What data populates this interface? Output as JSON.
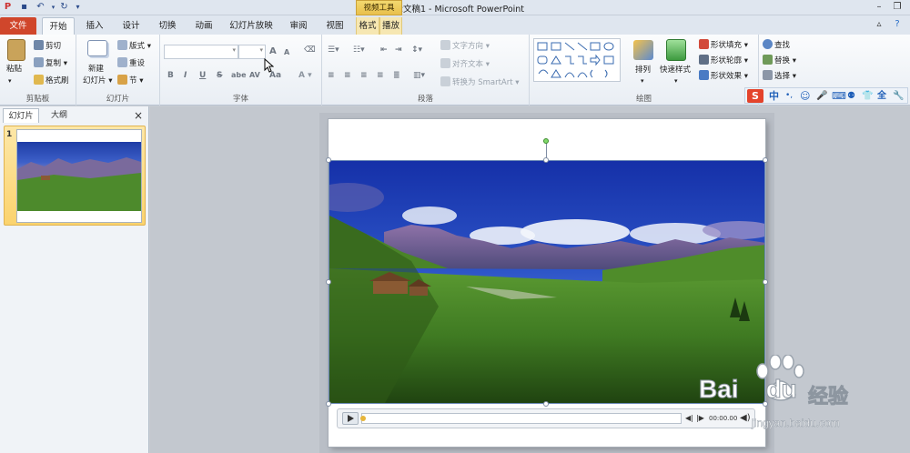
{
  "titlebar": {
    "title": "演示文稿1 - Microsoft PowerPoint",
    "context_tab_header": "视频工具"
  },
  "tabs": [
    "文件",
    "开始",
    "插入",
    "设计",
    "切换",
    "动画",
    "幻灯片放映",
    "审阅",
    "视图",
    "格式",
    "播放"
  ],
  "ribbon": {
    "clipboard": {
      "paste": "粘贴",
      "cut": "剪切",
      "copy": "复制",
      "format_painter": "格式刷",
      "label": "剪贴板"
    },
    "slides": {
      "new_slide_1": "新建",
      "new_slide_2": "幻灯片",
      "layout": "版式",
      "reset": "重设",
      "section": "节",
      "label": "幻灯片"
    },
    "font": {
      "bold": "B",
      "italic": "I",
      "underline": "U",
      "strike": "S",
      "shadow": "abe",
      "spacing": "AV",
      "case": "Aa",
      "grow": "A",
      "shrink": "A",
      "label": "字体"
    },
    "paragraph": {
      "text_direction": "文字方向",
      "align_text": "对齐文本",
      "smartart": "转换为 SmartArt",
      "label": "段落"
    },
    "drawing": {
      "arrange": "排列",
      "quick_styles": "快速样式",
      "shape_fill": "形状填充",
      "shape_outline": "形状轮廓",
      "shape_effects": "形状效果",
      "label": "绘图"
    },
    "editing": {
      "find": "查找",
      "replace": "替换",
      "select": "选择"
    }
  },
  "sogou": {
    "logo": "S",
    "mode": "中",
    "punct": "•,",
    "emoji": "☺",
    "mic": "🎤",
    "keyboard": "⌨",
    "skin": "👕",
    "full": "全",
    "tools": "🔧"
  },
  "panel": {
    "tab_slides": "幻灯片",
    "tab_outline": "大纲",
    "close": "×",
    "slide_number": "1"
  },
  "player": {
    "time": "00:00.00"
  },
  "watermark": {
    "brand": "Bai",
    "brand2": "du",
    "cn": "经验",
    "url": "jingyan.baidu.com"
  },
  "colors": {
    "file_tab": "#d0462b",
    "accent": "#2a5aa8",
    "context": "#e9c04c"
  }
}
